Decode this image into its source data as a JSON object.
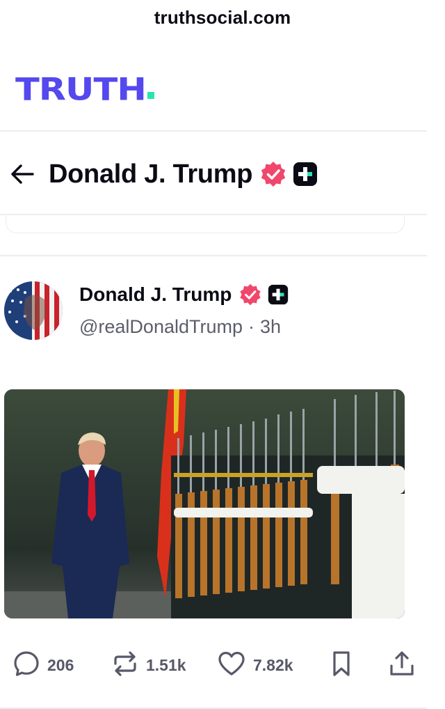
{
  "browser": {
    "url": "truthsocial.com"
  },
  "brand": {
    "logo_text": "TRUTH",
    "primary": "#5448ee",
    "accent": "#2ce3b0"
  },
  "profile_header": {
    "name": "Donald J. Trump",
    "back_icon": "arrow-left-icon",
    "verified_icon": "verified-badge-icon",
    "plus_icon": "truth-plus-icon"
  },
  "post": {
    "author_name": "Donald J. Trump",
    "handle": "@realDonaldTrump",
    "separator": "·",
    "time": "3h",
    "image_subject": "photo"
  },
  "actions": {
    "reply_count": "206",
    "retruth_count": "1.51k",
    "like_count": "7.82k",
    "reply_icon": "comment-icon",
    "retruth_icon": "repost-icon",
    "like_icon": "heart-icon",
    "bookmark_icon": "bookmark-icon",
    "share_icon": "share-icon"
  },
  "colors": {
    "verified": "#f0476b",
    "text": "#0b0b16",
    "muted": "#5c5d6b",
    "divider": "#ececf1"
  }
}
